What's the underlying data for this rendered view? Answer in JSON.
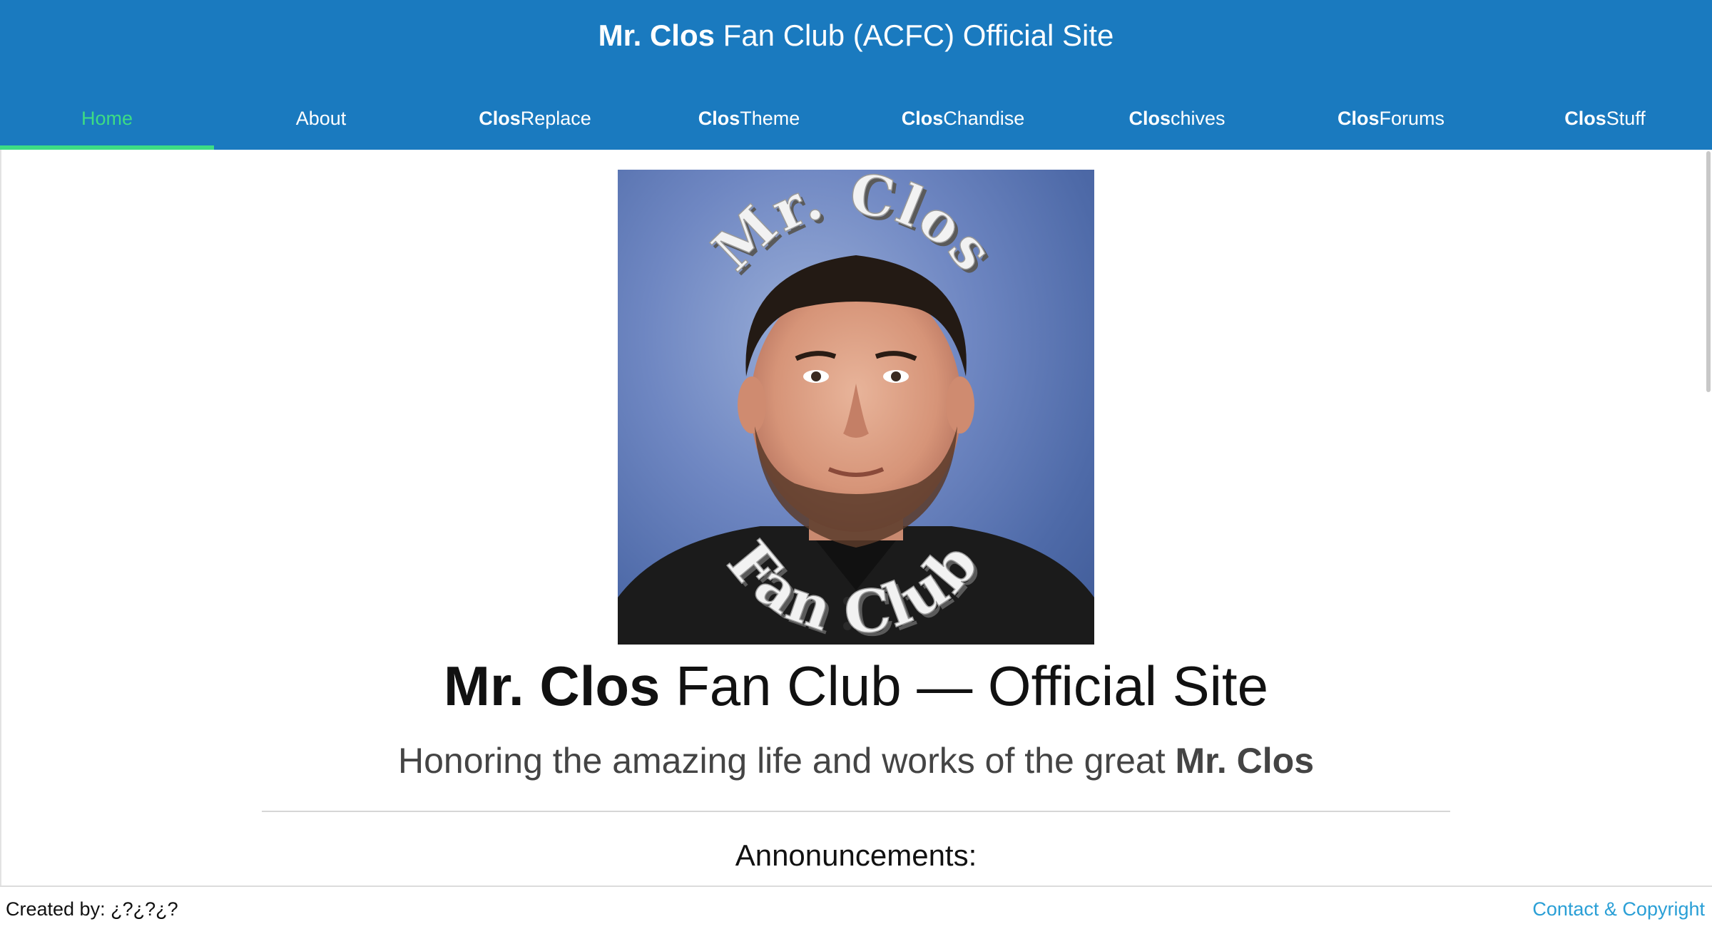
{
  "header": {
    "title_bold": "Mr. Clos",
    "title_rest": " Fan Club (ACFC) Official Site",
    "background_color": "#1a7abf",
    "active_color": "#3ddc84"
  },
  "nav": {
    "items": [
      {
        "bold": "",
        "label": "Home",
        "active": true
      },
      {
        "bold": "",
        "label": "About",
        "active": false
      },
      {
        "bold": "Clos",
        "label": "Replace",
        "active": false
      },
      {
        "bold": "Clos",
        "label": "Theme",
        "active": false
      },
      {
        "bold": "Clos",
        "label": "Chandise",
        "active": false
      },
      {
        "bold": "Clos",
        "label": "chives",
        "active": false
      },
      {
        "bold": "Clos",
        "label": "Forums",
        "active": false
      },
      {
        "bold": "Clos",
        "label": "Stuff",
        "active": false
      }
    ]
  },
  "logo": {
    "top_text": "Mr. Clos",
    "bottom_text": "Fan Club"
  },
  "main": {
    "heading_bold": "Mr. Clos",
    "heading_rest": " Fan Club — Official Site",
    "subheading_text": "Honoring the amazing life and works of the great ",
    "subheading_bold": "Mr. Clos",
    "announcements_label": "Annonuncements:"
  },
  "footer": {
    "created_by": "Created by: ¿?¿?¿?",
    "contact_link": "Contact & Copyright",
    "link_color": "#2a9fd6"
  }
}
